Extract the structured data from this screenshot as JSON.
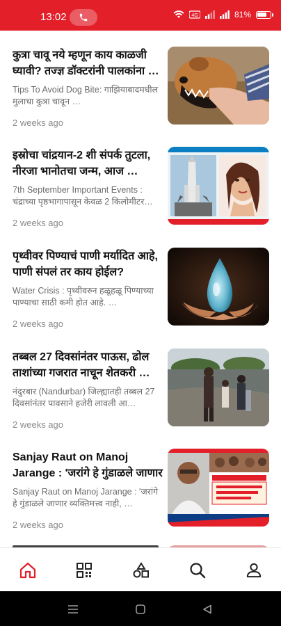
{
  "status_bar": {
    "time": "13:02",
    "battery": "81%",
    "accent_color": "#e31f2a"
  },
  "feed": [
    {
      "headline": "कुत्रा चावू नये म्हणून काय काळजी घ्यावी? तज्ज्ञ डॉक्टरांनी पालकांना …",
      "summary": "Tips To Avoid Dog Bite: गाझियाबादमधील मुलाचा कुत्रा चावून …",
      "time": "2 weeks ago",
      "image": "dog-bite-photo"
    },
    {
      "headline": "इस्रोचा चांद्रयान-2 शी संपर्क तुटला, नीरजा भानोतचा जन्म, आज …",
      "summary": "7th September Important Events : चंद्राच्या पृष्ठभागापासून केवळ 2 किलोमीटर…",
      "time": "2 weeks ago",
      "image": "chandrayaan-collage"
    },
    {
      "headline": "पृथ्वीवर पिण्याचं पाणी मर्यादित आहे, पाणी संपलं तर काय होईल?",
      "summary": "Water Crisis : पृथ्वीवरुन हळूहळू पिण्याच्या पाण्याचा साठी कमी होत आहे. …",
      "time": "2 weeks ago",
      "image": "water-drop-hands"
    },
    {
      "headline": "तब्बल 27 दिवसांनंतर पाऊस, ढोल ताशांच्या गजरात नाचून शेतकरी …",
      "summary": "नंदुरबार (Nandurbar) जिल्ह्यातही तब्बल 27 दिवसांनंतर पावसाने हजेरी लावली आ…",
      "time": "2 weeks ago",
      "image": "farmers-rain"
    },
    {
      "headline": "Sanjay Raut on Manoj Jarange : 'जरांगे हे गुंडाळले जाणार …",
      "summary": "Sanjay Raut on Manoj Jarange : 'जरांगे हे गुंडाळले जाणार व्यक्तिमत्त्व नाही, …",
      "time": "2 weeks ago",
      "image": "news-channel-collage"
    }
  ],
  "bottom_nav": [
    "home-icon",
    "categories-icon",
    "shapes-icon",
    "search-icon",
    "profile-icon"
  ]
}
